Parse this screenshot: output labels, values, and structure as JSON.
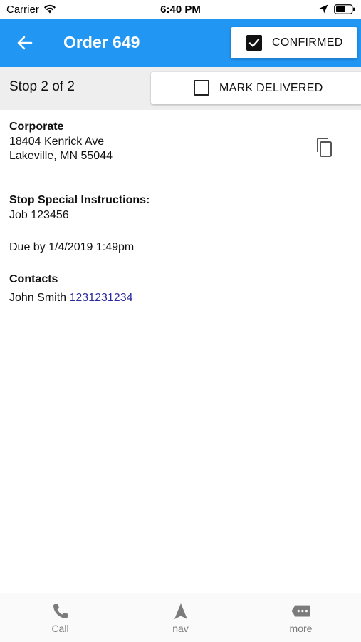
{
  "status_bar": {
    "carrier": "Carrier",
    "time": "6:40 PM"
  },
  "header": {
    "title": "Order 649",
    "confirm_label": "CONFIRMED",
    "confirmed": true,
    "color": "#2196f3"
  },
  "stop_bar": {
    "stop_text": "Stop 2 of 2",
    "deliver_label": "MARK DELIVERED",
    "delivered": false
  },
  "stop": {
    "name": "Corporate",
    "address_line1": "18404 Kenrick Ave",
    "address_line2": "Lakeville, MN 55044",
    "instructions_heading": "Stop Special Instructions:",
    "instructions": "Job 123456",
    "due": "Due by 1/4/2019 1:49pm",
    "contacts_heading": "Contacts",
    "contact_name": "John Smith",
    "contact_phone": "1231231234"
  },
  "tabs": [
    {
      "label": "Call",
      "icon": "phone-icon"
    },
    {
      "label": "nav",
      "icon": "navigation-arrow-icon"
    },
    {
      "label": "more",
      "icon": "more-message-icon"
    }
  ],
  "icons": {
    "back": "back-arrow-icon",
    "copy": "copy-icon",
    "wifi": "wifi-icon",
    "location": "location-arrow-icon",
    "battery": "battery-icon"
  }
}
